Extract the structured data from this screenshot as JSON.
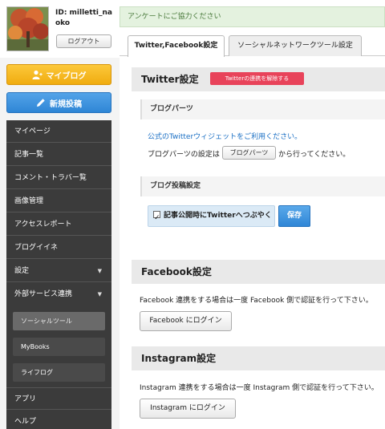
{
  "user": {
    "id": "ID: milletti_naoko",
    "logout_label": "ログアウト"
  },
  "sidebar": {
    "myblog_label": "マイブログ",
    "newpost_label": "新規投稿",
    "items": [
      {
        "label": "マイページ"
      },
      {
        "label": "記事一覧"
      },
      {
        "label": "コメント・トラバー覧"
      },
      {
        "label": "画像管理"
      },
      {
        "label": "アクセスレポート"
      },
      {
        "label": "ブログイイネ"
      },
      {
        "label": "設定",
        "arrow": "▼"
      },
      {
        "label": "外部サービス連携",
        "arrow": "▼"
      }
    ],
    "sub_items": [
      {
        "label": "ソーシャルツール"
      },
      {
        "label": "MyBooks"
      },
      {
        "label": "ライフログ"
      }
    ],
    "bottom_items": [
      {
        "label": "アプリ"
      },
      {
        "label": "ヘルプ"
      }
    ]
  },
  "notice": "アンケートにご協力ください",
  "tabs": [
    {
      "label": "Twitter,Facebook設定"
    },
    {
      "label": "ソーシャルネットワークツール設定"
    }
  ],
  "twitter": {
    "title": "Twitter設定",
    "unlink_label": "Twitterの連携を解除する",
    "blogparts_title": "ブログパーツ",
    "widget_link": "公式のTwitterウィジェットをご利用ください。",
    "blogparts_prefix": "ブログパーツの設定は",
    "blogparts_button": "ブログパーツ",
    "blogparts_suffix": "から行ってください。",
    "post_title": "ブログ投稿設定",
    "tweet_toggle": "記事公開時にTwitterへつぶやく",
    "save_label": "保存"
  },
  "facebook": {
    "title": "Facebook設定",
    "description": "Facebook 連携をする場合は一度 Facebook 側で認証を行って下さい。",
    "login_label": "Facebook にログイン"
  },
  "instagram": {
    "title": "Instagram設定",
    "description": "Instagram 連携をする場合は一度 Instagram 側で認証を行って下さい。",
    "login_label": "Instagram にログイン"
  },
  "colors": {
    "myblog": "#f5b51d",
    "newpost": "#3a8ede",
    "unlink": "#e8435a",
    "nav_bg": "#3b3b3b"
  },
  "icons": {
    "myblog": "person-plus-icon",
    "newpost": "pencil-icon"
  }
}
